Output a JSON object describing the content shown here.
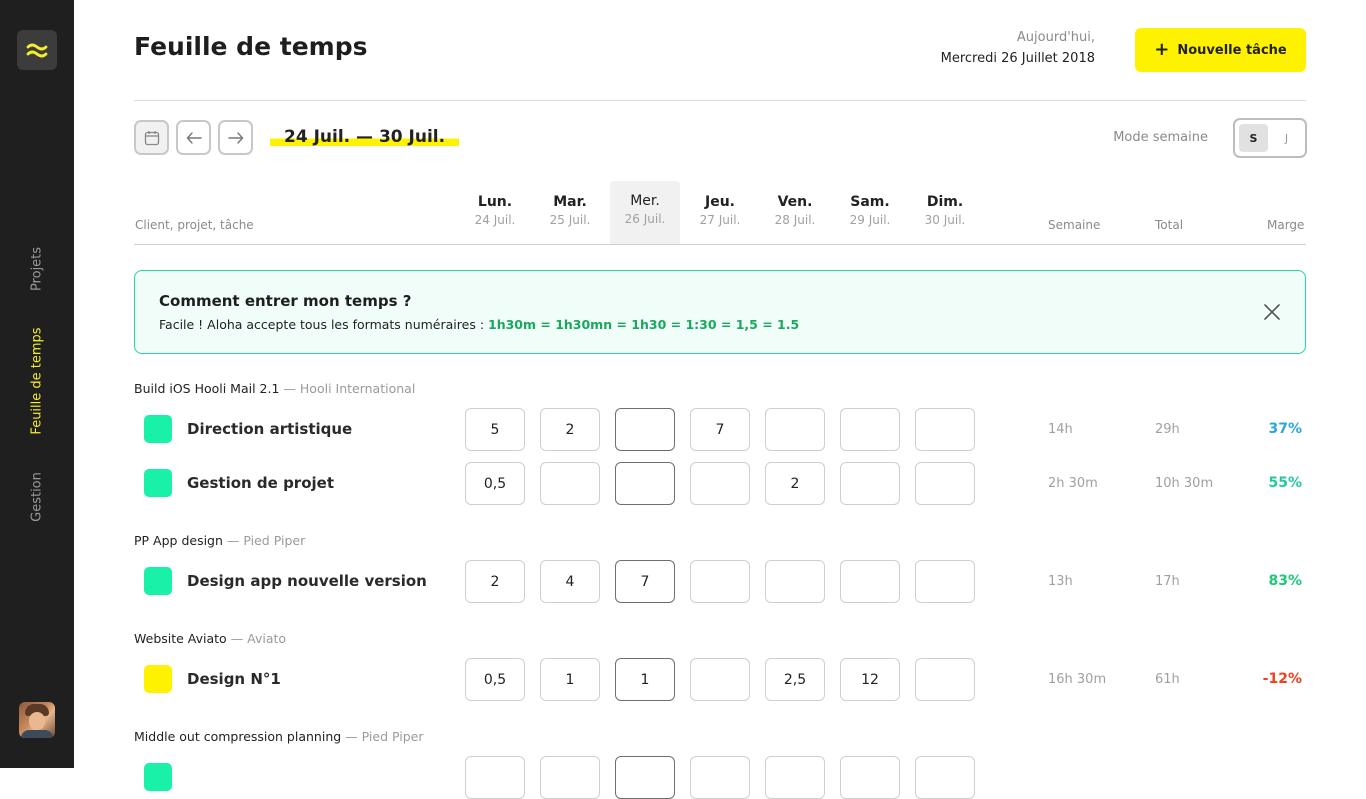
{
  "sidebar": {
    "logo_icon": "wave-logo-icon",
    "items": [
      {
        "label": "Projets",
        "active": false
      },
      {
        "label": "Feuille de temps",
        "active": true
      },
      {
        "label": "Gestion",
        "active": false
      }
    ],
    "accent": "#f7ee2a"
  },
  "header": {
    "title": "Feuille de temps",
    "today_label": "Aujourd'hui,",
    "today_date": "Mercredi 26 Juillet 2018",
    "new_task_label": "Nouvelle tâche",
    "new_task_color": "#fff200"
  },
  "toolbar": {
    "range": "24 Juil. — 30 Juil.",
    "mode_label": "Mode semaine",
    "mode_options": [
      "S",
      "J"
    ],
    "mode_selected": "S"
  },
  "columns": {
    "left": "Client, projet, tâche",
    "days": [
      {
        "name": "Lun.",
        "date": "24 Juil."
      },
      {
        "name": "Mar.",
        "date": "25 Juil."
      },
      {
        "name": "Mer.",
        "date": "26 Juil."
      },
      {
        "name": "Jeu.",
        "date": "27 Juil."
      },
      {
        "name": "Ven.",
        "date": "28 Juil."
      },
      {
        "name": "Sam.",
        "date": "29 Juil."
      },
      {
        "name": "Dim.",
        "date": "30 Juil."
      }
    ],
    "week": "Semaine",
    "total": "Total",
    "margin": "Marge"
  },
  "info": {
    "title": "Comment entrer mon temps ?",
    "text": "Facile ! Aloha accepte tous les formats numéraires : ",
    "formats": "1h30m = 1h30mn = 1h30 = 1:30 = 1,5 = 1.5"
  },
  "groups": [
    {
      "project": "Build iOS Hooli Mail 2.1",
      "client": "— Hooli International",
      "tasks": [
        {
          "name": "Direction artistique",
          "color": "#19f0a8",
          "hours": [
            "5",
            "2",
            "",
            "7",
            "",
            "",
            ""
          ],
          "week": "14h",
          "total": "29h",
          "margin": "37%",
          "margin_color": "#2ba7e0"
        },
        {
          "name": "Gestion de projet",
          "color": "#19f0a8",
          "hours": [
            "0,5",
            "",
            "",
            "",
            "2",
            "",
            ""
          ],
          "week": "2h 30m",
          "total": "10h 30m",
          "margin": "55%",
          "margin_color": "#22c9a0"
        }
      ]
    },
    {
      "project": "PP App design",
      "client": "— Pied Piper",
      "tasks": [
        {
          "name": "Design app nouvelle version",
          "color": "#19f0a8",
          "hours": [
            "2",
            "4",
            "7",
            "",
            "",
            "",
            ""
          ],
          "week": "13h",
          "total": "17h",
          "margin": "83%",
          "margin_color": "#1fc77a"
        }
      ]
    },
    {
      "project": "Website Aviato",
      "client": "— Aviato",
      "tasks": [
        {
          "name": "Design N°1",
          "color": "#fff200",
          "hours": [
            "0,5",
            "1",
            "1",
            "",
            "2,5",
            "12",
            ""
          ],
          "week": "16h 30m",
          "total": "61h",
          "margin": "-12%",
          "margin_color": "#f0401f"
        }
      ]
    },
    {
      "project": "Middle out compression planning",
      "client": "— Pied Piper",
      "tasks": [
        {
          "name": "",
          "color": "#19f0a8",
          "hours": [
            "",
            "",
            "",
            "",
            "",
            "",
            ""
          ],
          "week": "",
          "total": "",
          "margin": "",
          "margin_color": "#222222"
        }
      ]
    }
  ]
}
